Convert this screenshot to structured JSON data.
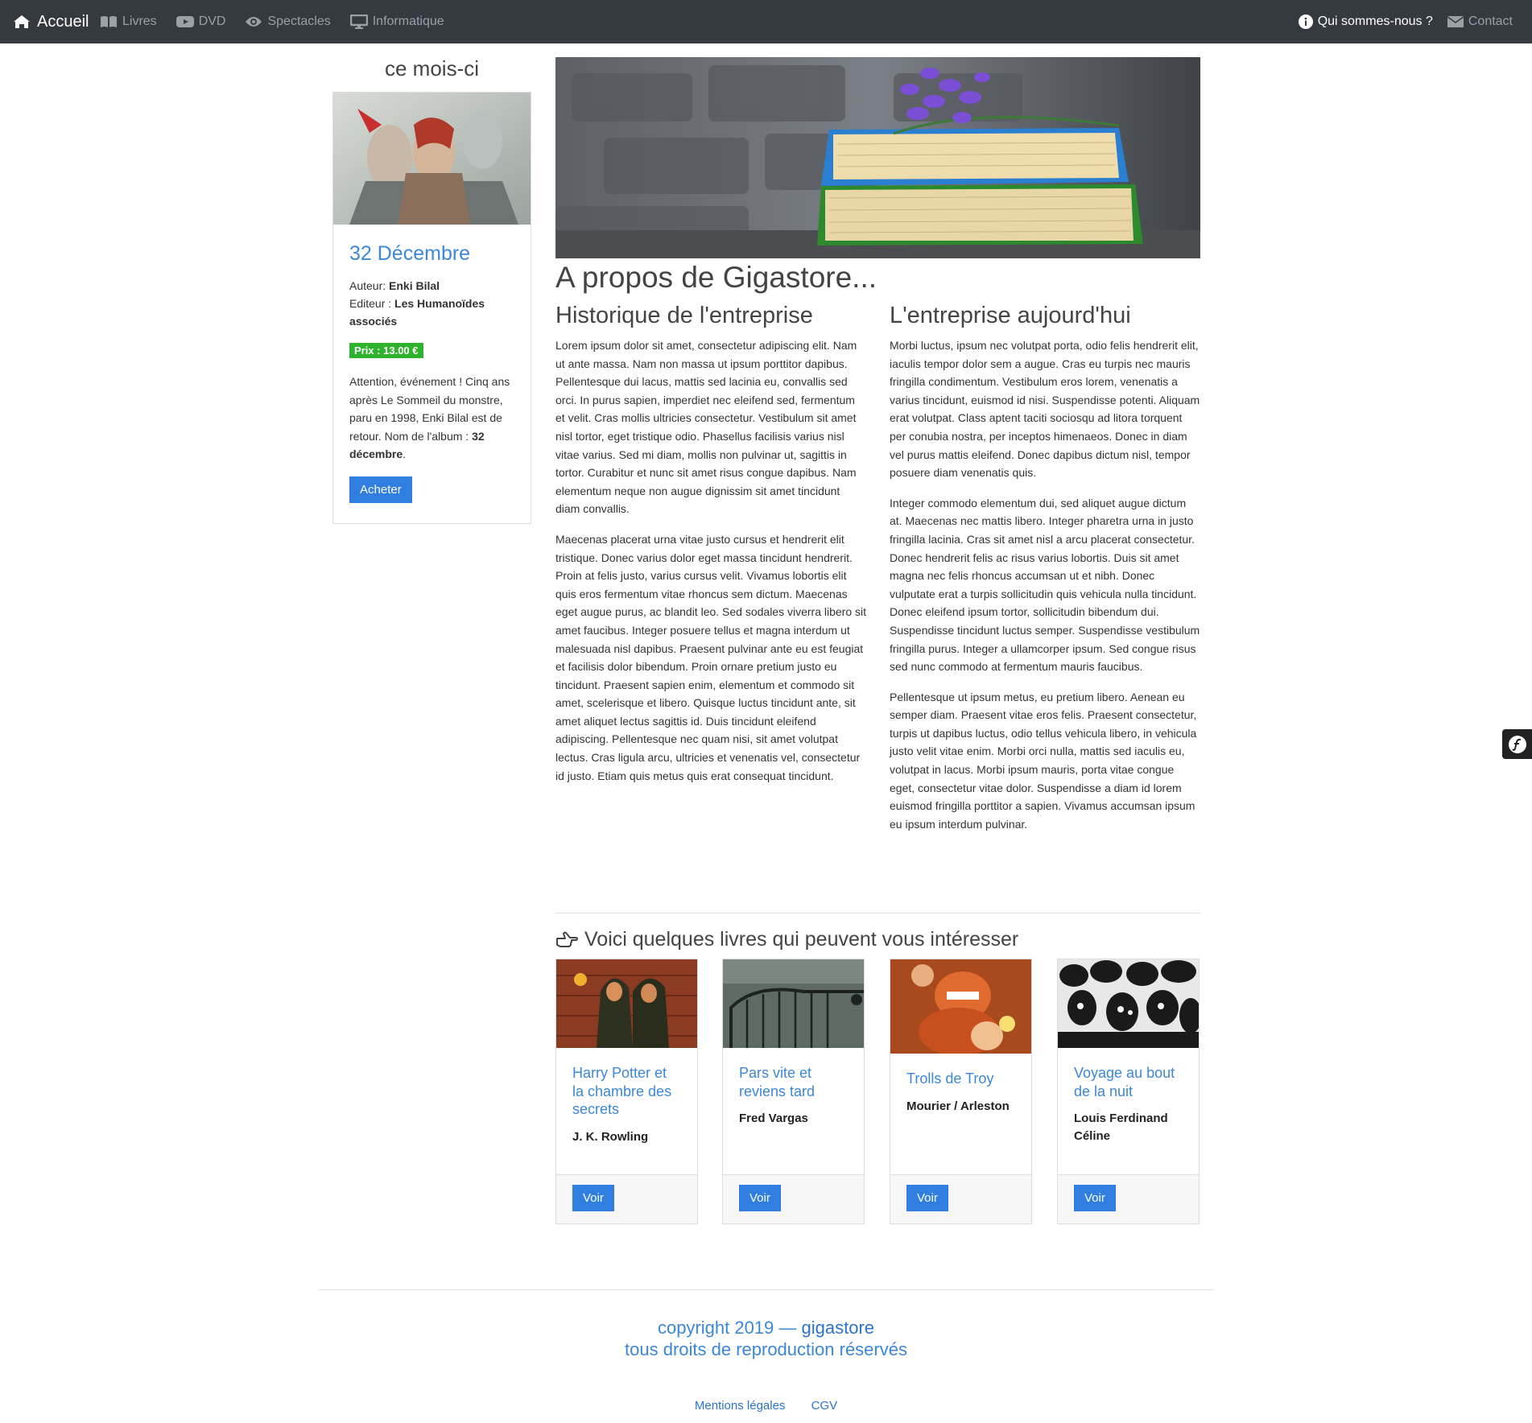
{
  "navbar": {
    "brand": "Accueil",
    "links": [
      "Livres",
      "DVD",
      "Spectacles",
      "Informatique"
    ],
    "right": [
      "Qui sommes-nous ?",
      "Contact"
    ]
  },
  "sidebar": {
    "heading": "ce mois-ci",
    "title": "32 Décembre",
    "author_label": "Auteur:",
    "author": "Enki Bilal",
    "editor_label": "Editeur :",
    "editor": "Les Humanoïdes associés",
    "price": "Prix : 13.00 €",
    "desc_text": "Attention, événement ! Cinq ans après Le Sommeil du monstre, paru en 1998, Enki Bilal est de retour. Nom de l'album :",
    "desc_bold": "32 décembre",
    "desc_end": ".",
    "button": "Acheter"
  },
  "about": {
    "title": "A propos de Gigastore...",
    "left_title": "Historique de l'entreprise",
    "left_p1": "Lorem ipsum dolor sit amet, consectetur adipiscing elit. Nam ut ante massa. Nam non massa ut ipsum porttitor dapibus. Pellentesque dui lacus, mattis sed lacinia eu, convallis sed orci. In purus sapien, imperdiet nec eleifend sed, fermentum et velit. Cras mollis ultricies consectetur. Vestibulum sit amet nisl tortor, eget tristique odio. Phasellus facilisis varius nisl vitae varius. Sed mi diam, mollis non pulvinar ut, sagittis in tortor. Curabitur et nunc sit amet risus congue dapibus. Nam elementum neque non augue dignissim sit amet tincidunt diam convallis.",
    "left_p2": "Maecenas placerat urna vitae justo cursus et hendrerit elit tristique. Donec varius dolor eget massa tincidunt hendrerit. Proin at felis justo, varius cursus velit. Vivamus lobortis elit quis eros fermentum vitae rhoncus sem dictum. Maecenas eget augue purus, ac blandit leo. Sed sodales viverra libero sit amet faucibus. Integer posuere tellus et magna interdum ut malesuada nisl dapibus. Praesent pulvinar ante eu est feugiat et facilisis dolor bibendum. Proin ornare pretium justo eu tincidunt. Praesent sapien enim, elementum et commodo sit amet, scelerisque et libero. Quisque luctus tincidunt ante, sit amet aliquet lectus sagittis id. Duis tincidunt eleifend adipiscing. Pellentesque nec quam nisi, sit amet volutpat lectus. Cras ligula arcu, ultricies et venenatis vel, consectetur id justo. Etiam quis metus quis erat consequat tincidunt.",
    "right_title": "L'entreprise aujourd'hui",
    "right_p1": "Morbi luctus, ipsum nec volutpat porta, odio felis hendrerit elit, iaculis tempor dolor sem a augue. Cras eu turpis nec mauris fringilla condimentum. Vestibulum eros lorem, venenatis a varius tincidunt, euismod id nisi. Suspendisse potenti. Aliquam erat volutpat. Class aptent taciti sociosqu ad litora torquent per conubia nostra, per inceptos himenaeos. Donec in diam vel purus mattis eleifend. Donec dapibus dictum nisl, tempor posuere diam venenatis quis.",
    "right_p2": "Integer commodo elementum dui, sed aliquet augue dictum at. Maecenas nec mattis libero. Integer pharetra urna in justo fringilla lacinia. Cras sit amet nisl a arcu placerat consectetur. Donec hendrerit felis ac risus varius lobortis. Duis sit amet magna nec felis rhoncus accumsan ut et nibh. Donec vulputate erat a turpis sollicitudin quis vehicula nulla tincidunt. Donec eleifend ipsum tortor, sollicitudin bibendum dui. Suspendisse tincidunt luctus semper. Suspendisse vestibulum fringilla purus. Integer a ullamcorper ipsum. Sed congue risus sed nunc commodo at fermentum mauris faucibus.",
    "right_p3": "Pellentesque ut ipsum metus, eu pretium libero. Aenean eu semper diam. Praesent vitae eros felis. Praesent consectetur, turpis ut dapibus luctus, odio tellus vehicula libero, in vehicula justo velit vitae enim. Morbi orci nulla, mattis sed iaculis eu, volutpat in lacus. Morbi ipsum mauris, porta vitae congue eget, consectetur vitae dolor. Suspendisse a diam id lorem euismod fringilla porttitor a sapien. Vivamus accumsan ipsum eu ipsum interdum pulvinar."
  },
  "reco": {
    "title": "Voici quelques livres qui peuvent vous intéresser",
    "books": [
      {
        "title": "Harry Potter et la chambre des secrets",
        "author": "J. K. Rowling",
        "button": "Voir"
      },
      {
        "title": "Pars vite et reviens tard",
        "author": "Fred Vargas",
        "button": "Voir"
      },
      {
        "title": "Trolls de Troy",
        "author": "Mourier / Arleston",
        "button": "Voir"
      },
      {
        "title": "Voyage au bout de la nuit",
        "author": "Louis Ferdinand Céline",
        "button": "Voir"
      }
    ]
  },
  "footer": {
    "copy_prefix": "copyright 2019 —",
    "brand": "gigastore",
    "rights": "tous droits de reproduction réservés",
    "links": [
      "Mentions légales",
      "CGV"
    ]
  },
  "colors": {
    "navbar": "#343a40",
    "accent": "#2f7ee0",
    "link": "#3b87d8",
    "price": "#2fb32f"
  }
}
